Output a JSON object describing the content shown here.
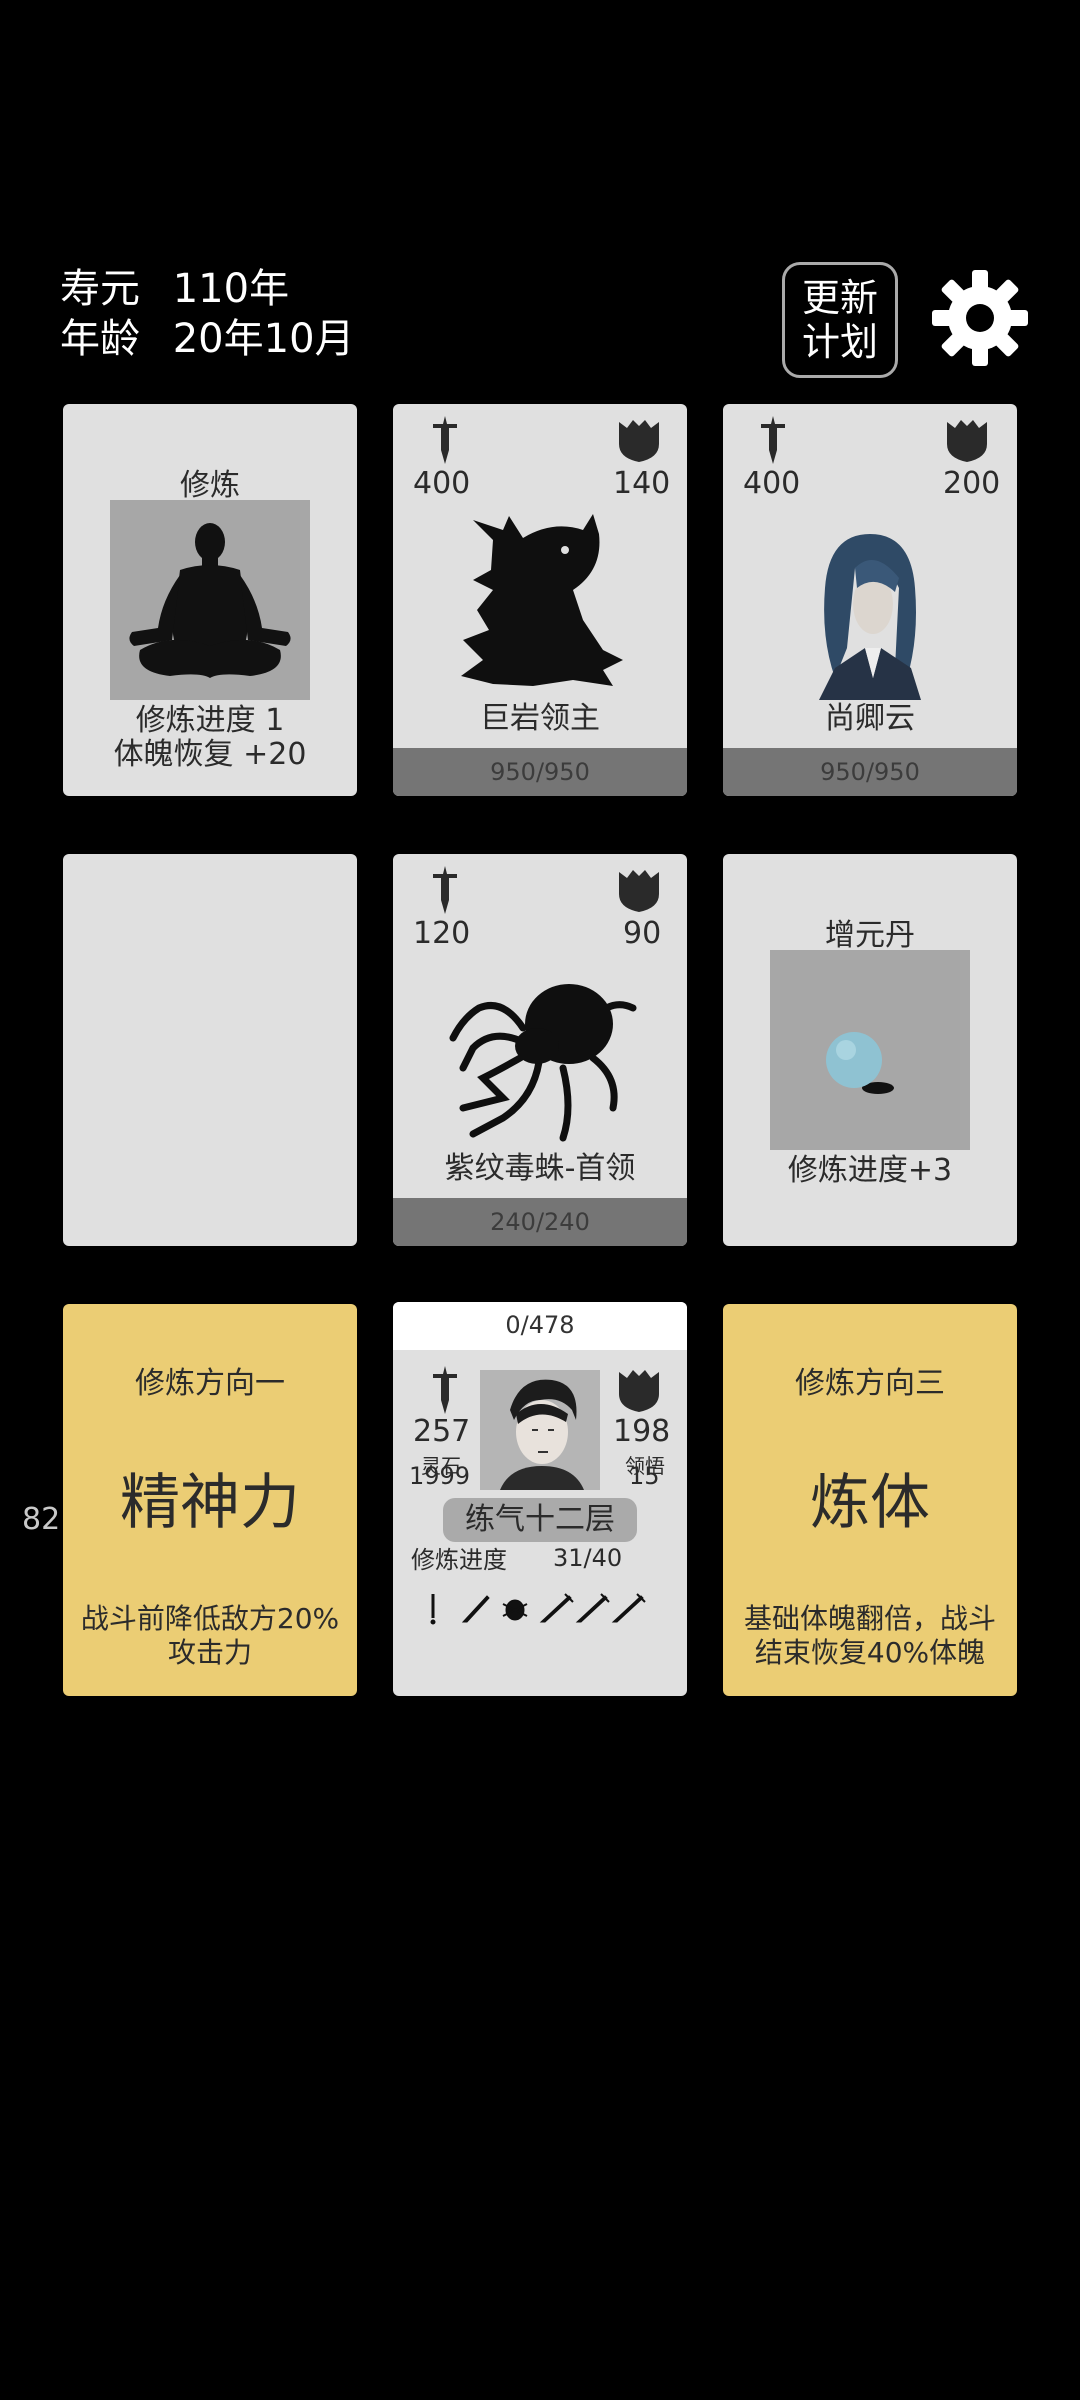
{
  "header": {
    "lifespan_label": "寿元",
    "lifespan_value": "110年",
    "age_label": "年龄",
    "age_value": "20年10月",
    "update_button_line1": "更新",
    "update_button_line2": "计划"
  },
  "cards": {
    "cultivate": {
      "title": "修炼",
      "line1": "修炼进度  1",
      "line2": "体魄恢复  +20"
    },
    "boss1": {
      "attack": "400",
      "defense": "140",
      "name": "巨岩领主",
      "hp": "950/950"
    },
    "npc1": {
      "attack": "400",
      "defense": "200",
      "name": "尚卿云",
      "hp": "950/950"
    },
    "spider": {
      "attack": "120",
      "defense": "90",
      "name": "紫纹毒蛛-首领",
      "hp": "240/240"
    },
    "pill": {
      "title": "增元丹",
      "effect": "修炼进度+3"
    },
    "direction1": {
      "title": "修炼方向一",
      "main": "精神力",
      "desc_line1": "战斗前降低敌方20%",
      "desc_line2": "攻击力"
    },
    "direction3": {
      "title": "修炼方向三",
      "main": "炼体",
      "desc_line1": "基础体魄翻倍，战斗",
      "desc_line2": "结束恢复40%体魄"
    }
  },
  "player": {
    "exp": "0/478",
    "attack": "257",
    "defense": "198",
    "spirit_stone_label": "灵石",
    "spirit_stone_value": "1999",
    "insight_label": "领悟",
    "insight_value": "15",
    "realm": "练气十二层",
    "progress_label": "修炼进度",
    "progress_value": "31/40"
  },
  "side_number": "82"
}
